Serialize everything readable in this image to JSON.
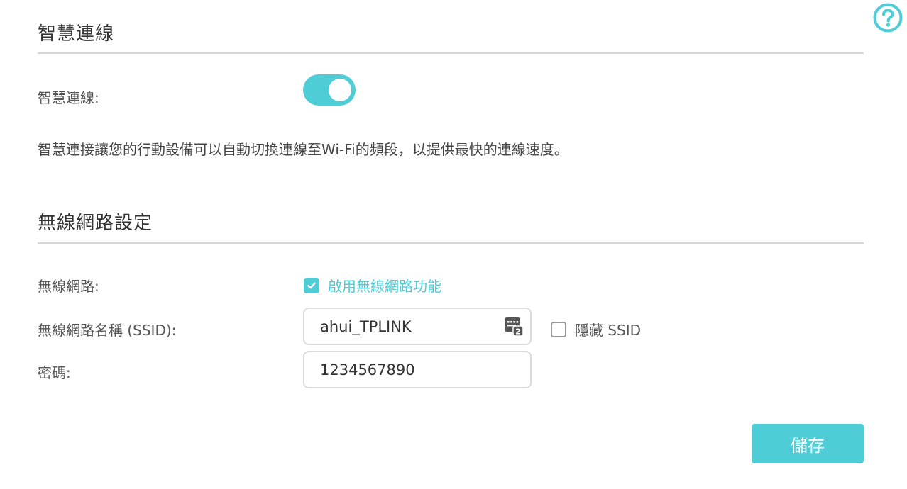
{
  "smart_connect": {
    "section_title": "智慧連線",
    "toggle_label": "智慧連線:",
    "enabled": true,
    "description": "智慧連接讓您的行動設備可以自動切換連線至Wi-Fi的頻段，以提供最快的連線速度。"
  },
  "wireless": {
    "section_title": "無線網路設定",
    "wireless_label": "無線網路:",
    "enable_checkbox_label": "啟用無線網路功能",
    "enable_checked": true,
    "ssid_label": "無線網路名稱 (SSID):",
    "ssid_value": "ahui_TPLINK",
    "hide_ssid_label": "隱藏 SSID",
    "hide_ssid_checked": false,
    "password_label": "密碼:",
    "password_value": "1234567890"
  },
  "actions": {
    "save_label": "儲存"
  },
  "colors": {
    "accent": "#4ecdd6",
    "divider": "#d6d6d6"
  },
  "icons": {
    "help": "help-circle-icon",
    "ssid_key": "ssid-keyboard-icon",
    "check": "checkmark-icon"
  }
}
